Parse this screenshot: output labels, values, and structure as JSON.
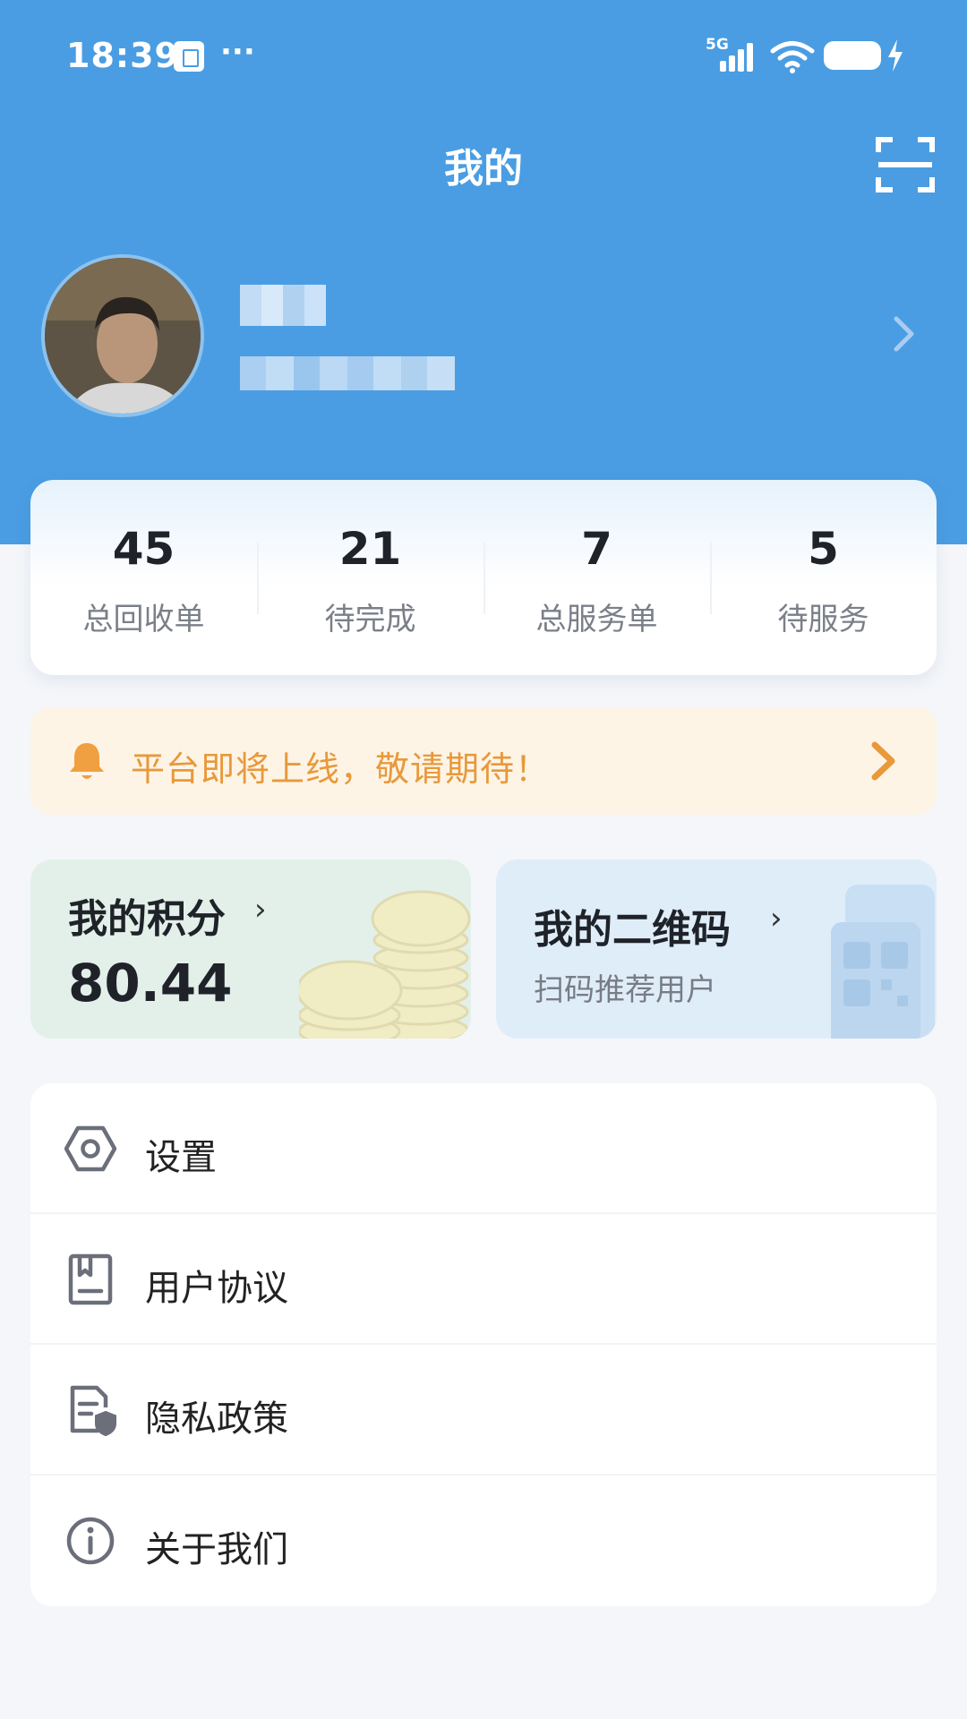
{
  "status_bar": {
    "time": "18:39",
    "more": "···",
    "network": "5G"
  },
  "header": {
    "title": "我的"
  },
  "stats": [
    {
      "value": "45",
      "label": "总回收单"
    },
    {
      "value": "21",
      "label": "待完成"
    },
    {
      "value": "7",
      "label": "总服务单"
    },
    {
      "value": "5",
      "label": "待服务"
    }
  ],
  "notice": {
    "text": "平台即将上线，敬请期待！"
  },
  "points": {
    "title": "我的积分",
    "arrow": "›",
    "value": "80.44"
  },
  "qrcode": {
    "title": "我的二维码",
    "arrow": "›",
    "subtitle": "扫码推荐用户"
  },
  "menu": {
    "items": [
      {
        "label": "设置",
        "icon": "settings-hexagon-icon"
      },
      {
        "label": "用户协议",
        "icon": "bookmark-doc-icon"
      },
      {
        "label": "隐私政策",
        "icon": "document-shield-icon"
      },
      {
        "label": "关于我们",
        "icon": "info-icon"
      }
    ]
  },
  "colors": {
    "primary": "#4a9de2",
    "notice_text": "#e8993a",
    "notice_bg": "#fdf4e6",
    "points_bg": "#e3f0ea",
    "qr_bg": "#dfedf9",
    "page_bg": "#f4f6f9"
  }
}
